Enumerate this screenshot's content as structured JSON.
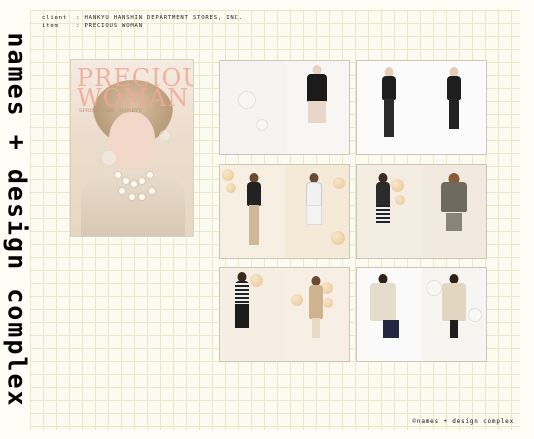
{
  "sidebar": {
    "title": "names + design complex"
  },
  "meta": {
    "client_label": "client",
    "client_value": "HANKYU HANSHIN DEPARTMENT STORES, INC.",
    "item_label": "item",
    "item_value": "PRECIOUS WOMAN"
  },
  "cover": {
    "title": "PRECIOUS WOMAN",
    "subtitle": "SPRING 2008 · HANKYU"
  },
  "footer": {
    "credit": "©names + design complex"
  },
  "colors": {
    "grid_line": "#ece8c6",
    "background": "#fbfbf1",
    "accent": "#f0a995"
  }
}
